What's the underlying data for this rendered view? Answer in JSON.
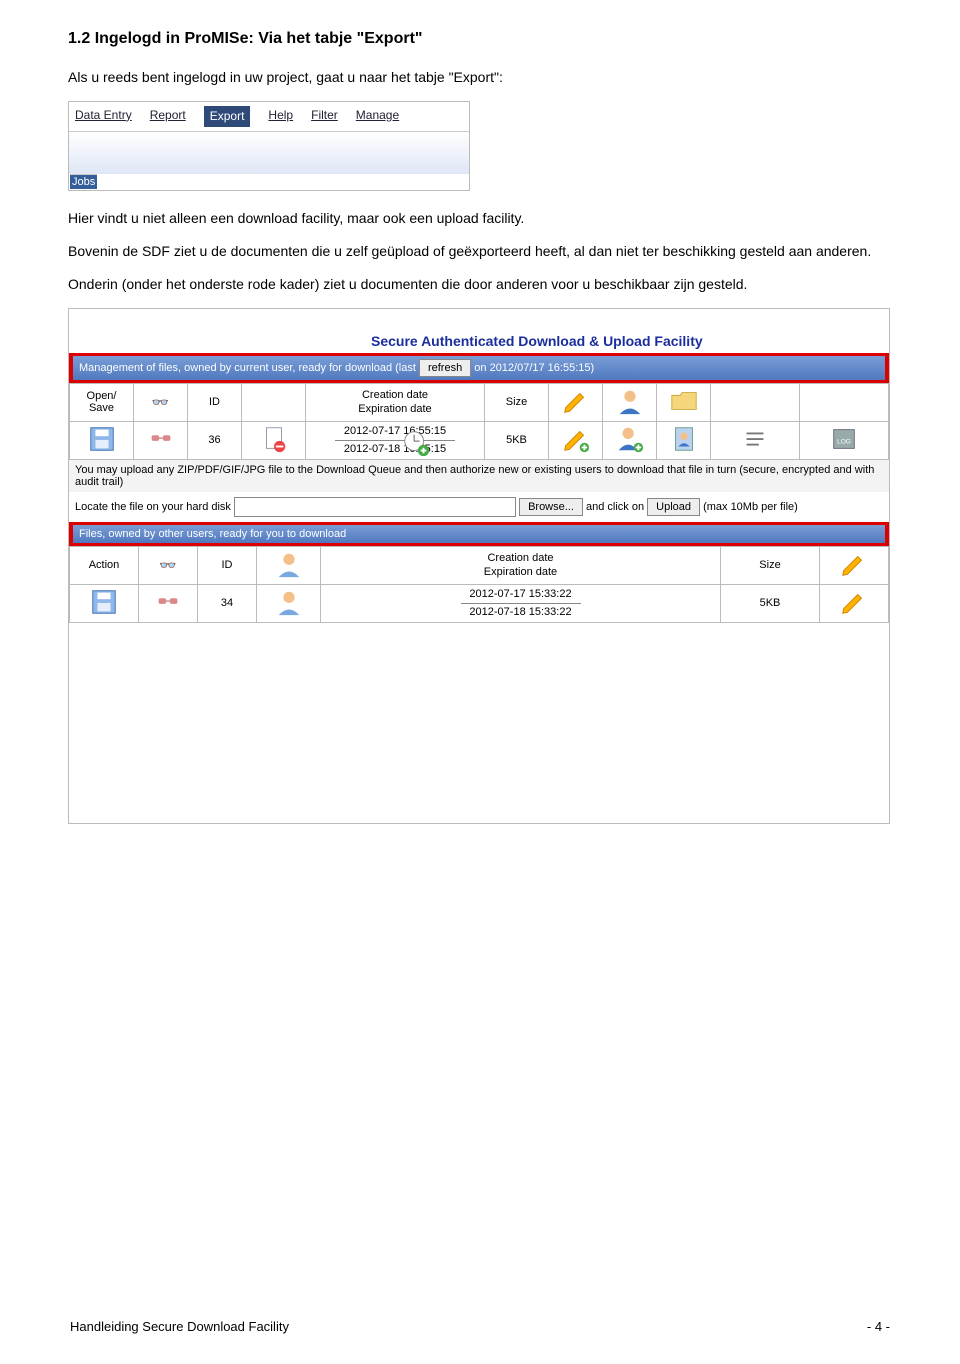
{
  "section_heading": "1.2   Ingelogd in ProMISe: Via het tabje \"Export\"",
  "para1": "Als u reeds bent ingelogd in uw project, gaat u naar het tabje \"Export\":",
  "tabs": {
    "items": [
      "Data Entry",
      "Report",
      "Export",
      "Help",
      "Filter",
      "Manage"
    ],
    "footer_tab": "Jobs"
  },
  "para2": "Hier vindt u niet alleen een download facility, maar ook een upload facility.",
  "para3": "Bovenin de SDF ziet u de documenten die u zelf geüpload of geëxporteerd heeft, al dan niet ter beschikking gesteld aan anderen.",
  "para4": "Onderin (onder het onderste rode kader) ziet u documenten die door anderen voor u beschikbaar zijn gesteld.",
  "panel": {
    "title": "Secure Authenticated Download & Upload Facility",
    "section1_bar_prefix": "Management of files, owned by current user, ready for download (last",
    "refresh_btn": "refresh",
    "section1_bar_suffix": " on 2012/07/17 16:55:15)",
    "hdr_open_save": "Open/\nSave",
    "hdr_id": "ID",
    "hdr_creation": "Creation date",
    "hdr_expiration": "Expiration date",
    "hdr_size": "Size",
    "row1_id": "36",
    "row1_created": "2012-07-17 16:55:15",
    "row1_expires": "2012-07-18 16:55:15",
    "row1_size": "5KB",
    "upload_note1": "You may upload any ZIP/PDF/GIF/JPG file to the Download Queue and then authorize new or existing users to download that file in turn (secure, encrypted and with audit trail)",
    "locate_label": "Locate the file on your hard disk",
    "browse_btn": "Browse...",
    "and_click": " and click on ",
    "upload_btn": "Upload",
    "max_note": "(max 10Mb per file)",
    "section2_bar": "Files, owned by other users, ready for you to download",
    "hdr_action": "Action",
    "row2_id": "34",
    "row2_created": "2012-07-17 15:33:22",
    "row2_expires": "2012-07-18 15:33:22",
    "row2_size": "5KB"
  },
  "footer_left": "Handleiding Secure Download Facility",
  "footer_right": "- 4 -"
}
